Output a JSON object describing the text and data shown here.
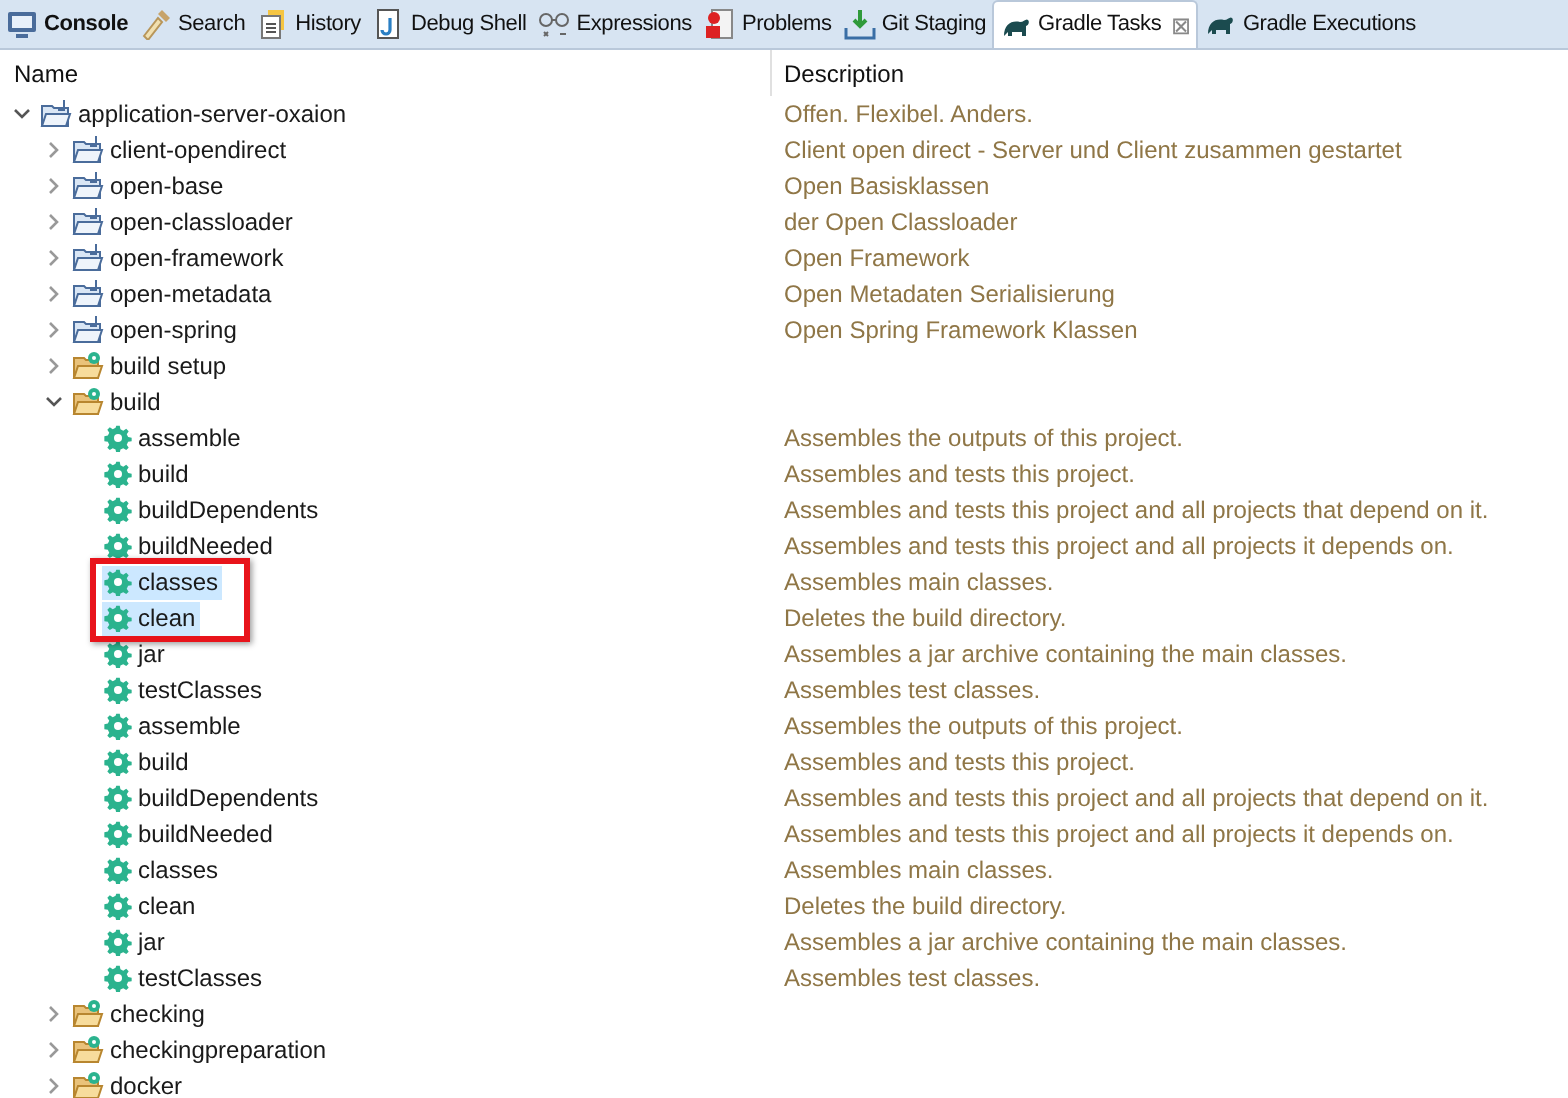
{
  "tabs": [
    {
      "label": "Console",
      "bold": true,
      "selected": false
    },
    {
      "label": "Search",
      "bold": false,
      "selected": false
    },
    {
      "label": "History",
      "bold": false,
      "selected": false
    },
    {
      "label": "Debug Shell",
      "bold": false,
      "selected": false
    },
    {
      "label": "Expressions",
      "bold": false,
      "selected": false
    },
    {
      "label": "Problems",
      "bold": false,
      "selected": false
    },
    {
      "label": "Git Staging",
      "bold": false,
      "selected": false
    },
    {
      "label": "Gradle Tasks",
      "bold": false,
      "selected": true,
      "close": "⊠"
    },
    {
      "label": "Gradle Executions",
      "bold": false,
      "selected": false
    }
  ],
  "columns": [
    "Name",
    "Description"
  ],
  "tree": [
    {
      "kind": "project",
      "name": "application-server-oxaion",
      "description": "Offen. Flexibel. Anders.",
      "expanded": true,
      "children": [
        {
          "kind": "project",
          "name": "client-opendirect",
          "description": "Client open direct - Server und Client zusammen gestartet",
          "expanded": false
        },
        {
          "kind": "project",
          "name": "open-base",
          "description": "Open Basisklassen",
          "expanded": false
        },
        {
          "kind": "project",
          "name": "open-classloader",
          "description": "der Open Classloader",
          "expanded": false
        },
        {
          "kind": "project",
          "name": "open-framework",
          "description": "Open Framework",
          "expanded": false
        },
        {
          "kind": "project",
          "name": "open-metadata",
          "description": "Open Metadaten Serialisierung",
          "expanded": false
        },
        {
          "kind": "project",
          "name": "open-spring",
          "description": "Open Spring Framework Klassen",
          "expanded": false
        },
        {
          "kind": "group",
          "name": "build setup",
          "expanded": false
        },
        {
          "kind": "group",
          "name": "build",
          "expanded": true,
          "children": [
            {
              "kind": "task",
              "name": "assemble",
              "description": "Assembles the outputs of this project.",
              "selected": false
            },
            {
              "kind": "task",
              "name": "build",
              "description": "Assembles and tests this project.",
              "selected": false
            },
            {
              "kind": "task",
              "name": "buildDependents",
              "description": "Assembles and tests this project and all projects that depend on it.",
              "selected": false
            },
            {
              "kind": "task",
              "name": "buildNeeded",
              "description": "Assembles and tests this project and all projects it depends on.",
              "selected": false
            },
            {
              "kind": "task",
              "name": "classes",
              "description": "Assembles main classes.",
              "selected": true
            },
            {
              "kind": "task",
              "name": "clean",
              "description": "Deletes the build directory.",
              "selected": true
            },
            {
              "kind": "task",
              "name": "jar",
              "description": "Assembles a jar archive containing the main classes.",
              "selected": false
            },
            {
              "kind": "task",
              "name": "testClasses",
              "description": "Assembles test classes.",
              "selected": false
            },
            {
              "kind": "task",
              "name": "assemble",
              "description": "Assembles the outputs of this project.",
              "selected": false
            },
            {
              "kind": "task",
              "name": "build",
              "description": "Assembles and tests this project.",
              "selected": false
            },
            {
              "kind": "task",
              "name": "buildDependents",
              "description": "Assembles and tests this project and all projects that depend on it.",
              "selected": false
            },
            {
              "kind": "task",
              "name": "buildNeeded",
              "description": "Assembles and tests this project and all projects it depends on.",
              "selected": false
            },
            {
              "kind": "task",
              "name": "classes",
              "description": "Assembles main classes.",
              "selected": false
            },
            {
              "kind": "task",
              "name": "clean",
              "description": "Deletes the build directory.",
              "selected": false
            },
            {
              "kind": "task",
              "name": "jar",
              "description": "Assembles a jar archive containing the main classes.",
              "selected": false
            },
            {
              "kind": "task",
              "name": "testClasses",
              "description": "Assembles test classes.",
              "selected": false
            }
          ]
        },
        {
          "kind": "group",
          "name": "checking",
          "expanded": false
        },
        {
          "kind": "group",
          "name": "checkingpreparation",
          "expanded": false
        },
        {
          "kind": "group",
          "name": "docker",
          "expanded": false
        }
      ]
    }
  ]
}
